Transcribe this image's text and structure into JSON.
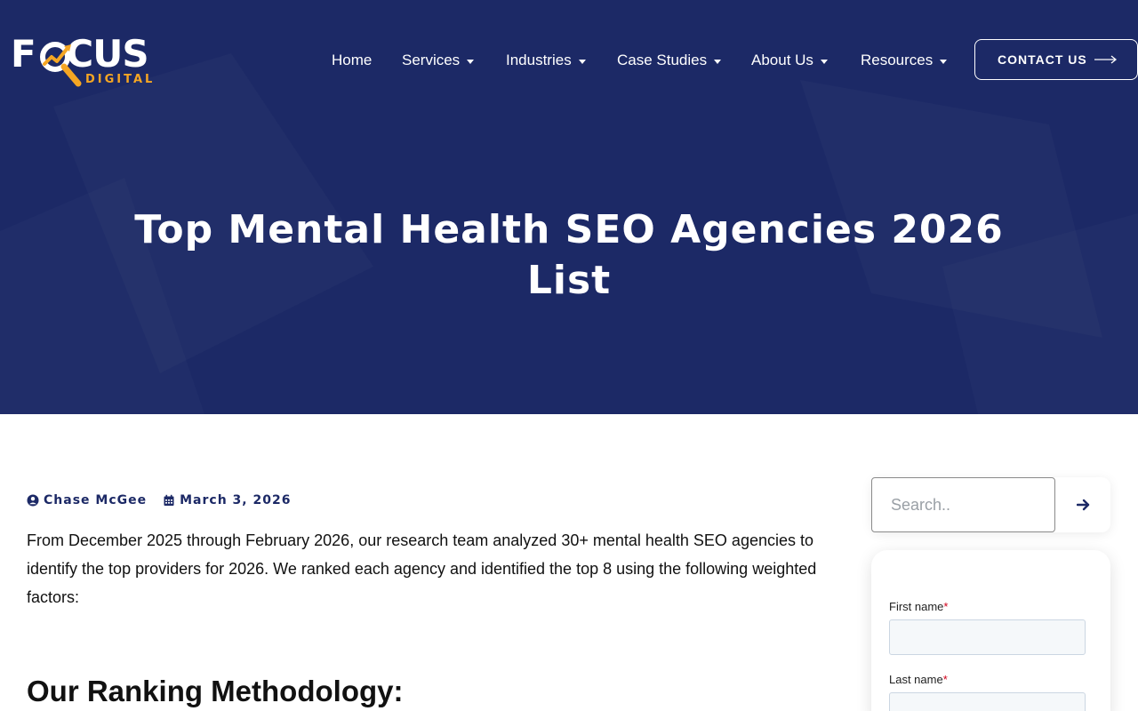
{
  "brand": {
    "logo_main_pre": "F",
    "logo_main_o": "O",
    "logo_main_post": "CUS",
    "logo_sub": "DIGITAL",
    "accent_color": "#f5a623",
    "header_bg": "#1c2966"
  },
  "nav": {
    "items": [
      {
        "label": "Home",
        "has_dropdown": false
      },
      {
        "label": "Services",
        "has_dropdown": true
      },
      {
        "label": "Industries",
        "has_dropdown": true
      },
      {
        "label": "Case Studies",
        "has_dropdown": true
      },
      {
        "label": "About Us",
        "has_dropdown": true
      },
      {
        "label": "Resources",
        "has_dropdown": true
      }
    ],
    "cta_label": "CONTACT US",
    "cta_icon": "long-arrow-right-icon"
  },
  "hero": {
    "title": "Top Mental Health SEO Agencies 2026 List"
  },
  "article": {
    "author": "Chase McGee",
    "author_icon": "user-circle-icon",
    "date": "March 3, 2026",
    "date_icon": "calendar-icon",
    "intro": "From December 2025 through February 2026, our research team analyzed 30+ mental health SEO agencies to identify the top providers for 2026. We ranked each agency and identified the top 8 using the following weighted factors:",
    "heading": "Our Ranking Methodology:"
  },
  "sidebar": {
    "search": {
      "placeholder": "Search..",
      "value": "",
      "button_icon": "arrow-right-icon"
    },
    "form": {
      "first_name_label": "First name",
      "last_name_label": "Last name",
      "required_mark": "*"
    }
  }
}
